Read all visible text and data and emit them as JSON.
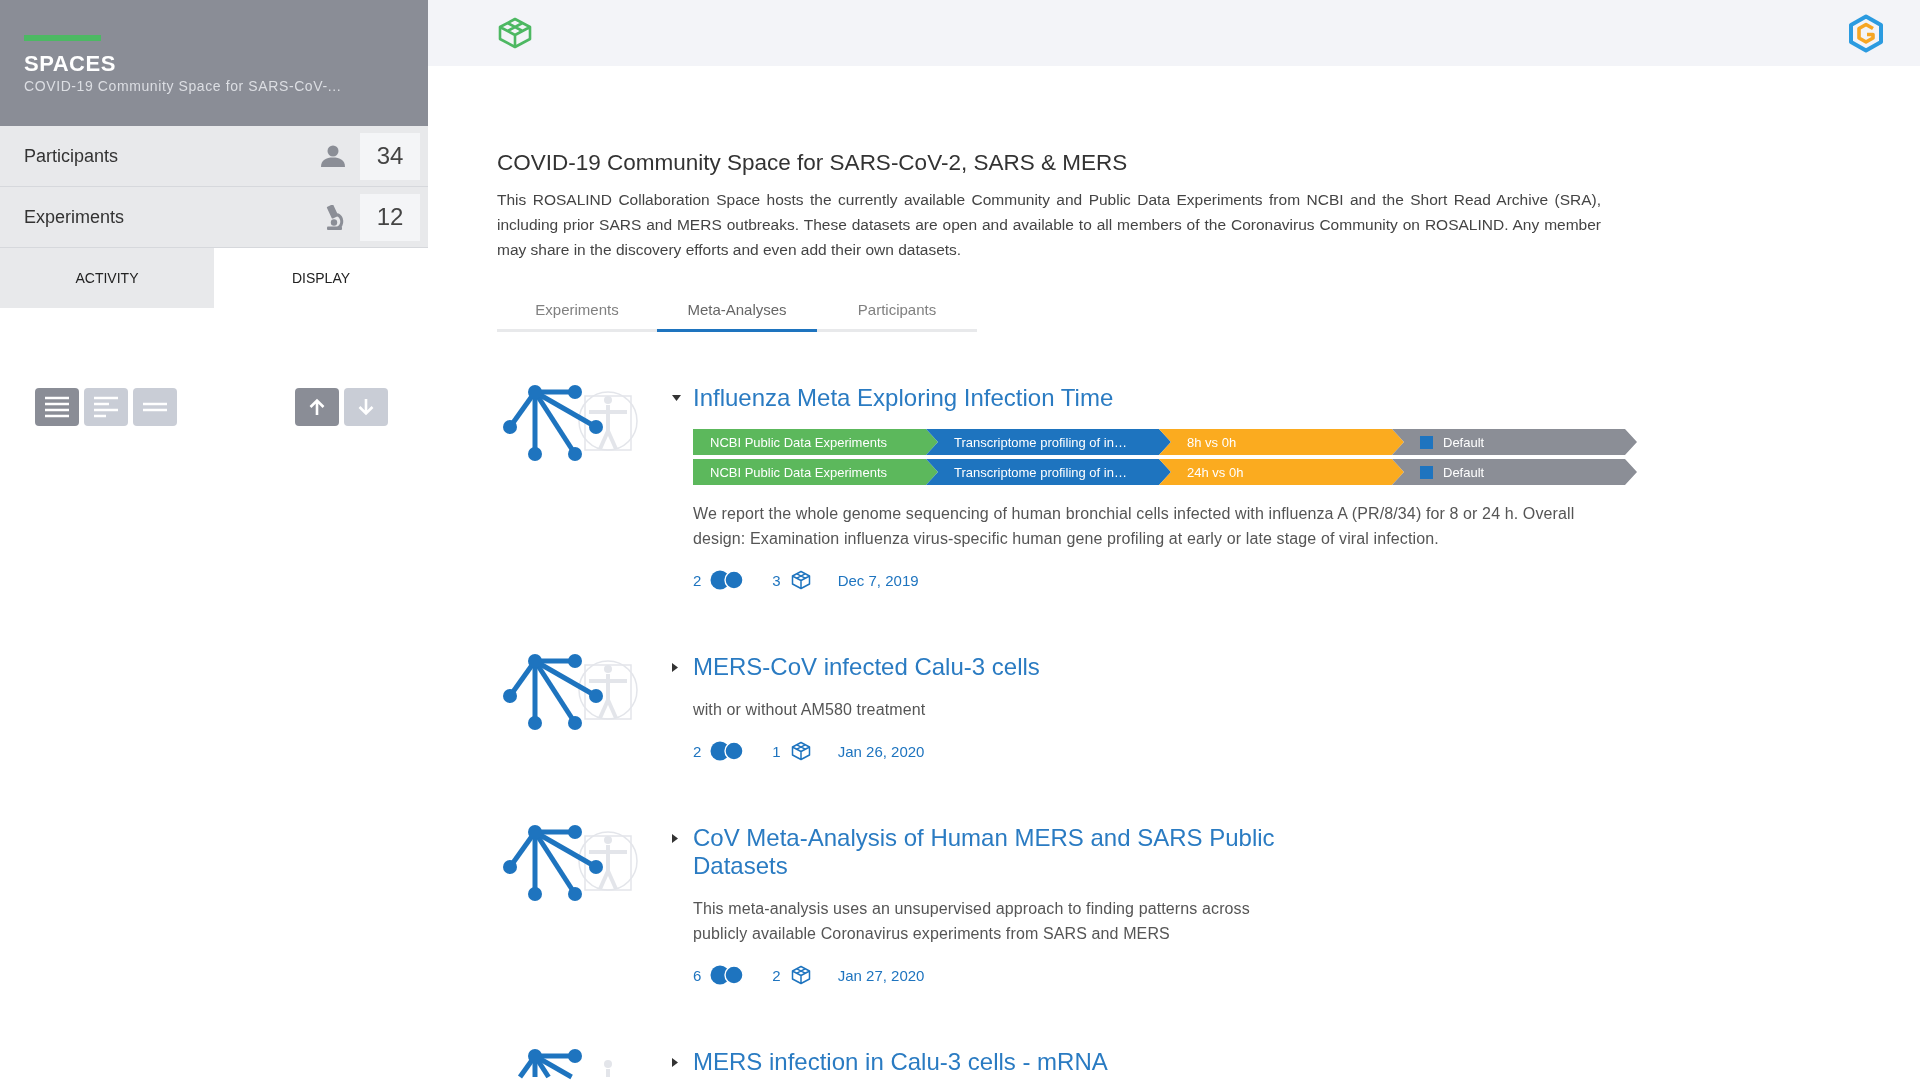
{
  "sidebar": {
    "title": "SPACES",
    "subtitle": "COVID-19 Community Space for SARS-CoV-...",
    "stats": [
      {
        "kind": "participants",
        "label": "Participants",
        "count": "34"
      },
      {
        "kind": "experiments",
        "label": "Experiments",
        "count": "12"
      }
    ],
    "tabs": [
      {
        "label": "ACTIVITY",
        "selected": false
      },
      {
        "label": "DISPLAY",
        "selected": true
      }
    ],
    "view_modes": [
      {
        "kind": "lines",
        "selected": true
      },
      {
        "kind": "ragged",
        "selected": false
      },
      {
        "kind": "compact",
        "selected": false
      }
    ],
    "sort_order": [
      {
        "kind": "up",
        "selected": true
      },
      {
        "kind": "down",
        "selected": false
      }
    ]
  },
  "space": {
    "title": "COVID-19 Community Space for SARS-CoV-2, SARS & MERS",
    "description": "This ROSALIND Collaboration Space hosts the currently available Community and Public Data Experiments from NCBI and the Short Read Archive (SRA), including prior SARS and MERS outbreaks. These datasets are open and available to all members of the Coronavirus Community on ROSALIND. Any member may share in the discovery efforts and even add their own datasets.",
    "tabs": [
      {
        "label": "Experiments",
        "selected": false
      },
      {
        "label": "Meta-Analyses",
        "selected": true
      },
      {
        "label": "Participants",
        "selected": false
      }
    ]
  },
  "meta_analyses": [
    {
      "title": "Influenza Meta Exploring Infection Time",
      "expanded": true,
      "comparisons": [
        {
          "segments": [
            {
              "label": "NCBI Public Data Experiments",
              "color": "#5cb85c"
            },
            {
              "label": "Transcriptome profiling of in…",
              "color": "#1e74bf"
            },
            {
              "label": "8h vs 0h",
              "color": "#fbab1f"
            },
            {
              "label": "Default",
              "color": "#8b8e96",
              "swatch": {
                "color": "#1e74bf"
              }
            }
          ]
        },
        {
          "segments": [
            {
              "label": "NCBI Public Data Experiments",
              "color": "#5cb85c"
            },
            {
              "label": "Transcriptome profiling of in…",
              "color": "#1e74bf"
            },
            {
              "label": "24h vs 0h",
              "color": "#fbab1f"
            },
            {
              "label": "Default",
              "color": "#8b8e96",
              "swatch": {
                "color": "#1e74bf"
              }
            }
          ]
        }
      ],
      "description": "We report the whole genome sequencing of human bronchial cells infected with influenza A (PR/8/34) for 8 or 24 h. Overall design: Examination influenza virus-specific human gene profiling at early or late stage of viral infection.",
      "sample_count": "2",
      "experiment_count": "3",
      "date": "Dec 7, 2019"
    },
    {
      "title": "MERS-CoV infected Calu-3 cells",
      "expanded": false,
      "description": "with or without AM580 treatment",
      "sample_count": "2",
      "experiment_count": "1",
      "date": "Jan 26, 2020"
    },
    {
      "title": "CoV Meta-Analysis of Human MERS and SARS Public Datasets",
      "expanded": false,
      "description": "This meta-analysis uses an unsupervised approach to finding patterns across publicly available Coronavirus experiments from SARS and MERS",
      "sample_count": "6",
      "experiment_count": "2",
      "date": "Jan 27, 2020"
    },
    {
      "title": "MERS infection in Calu-3 cells - mRNA",
      "expanded": false
    }
  ]
}
